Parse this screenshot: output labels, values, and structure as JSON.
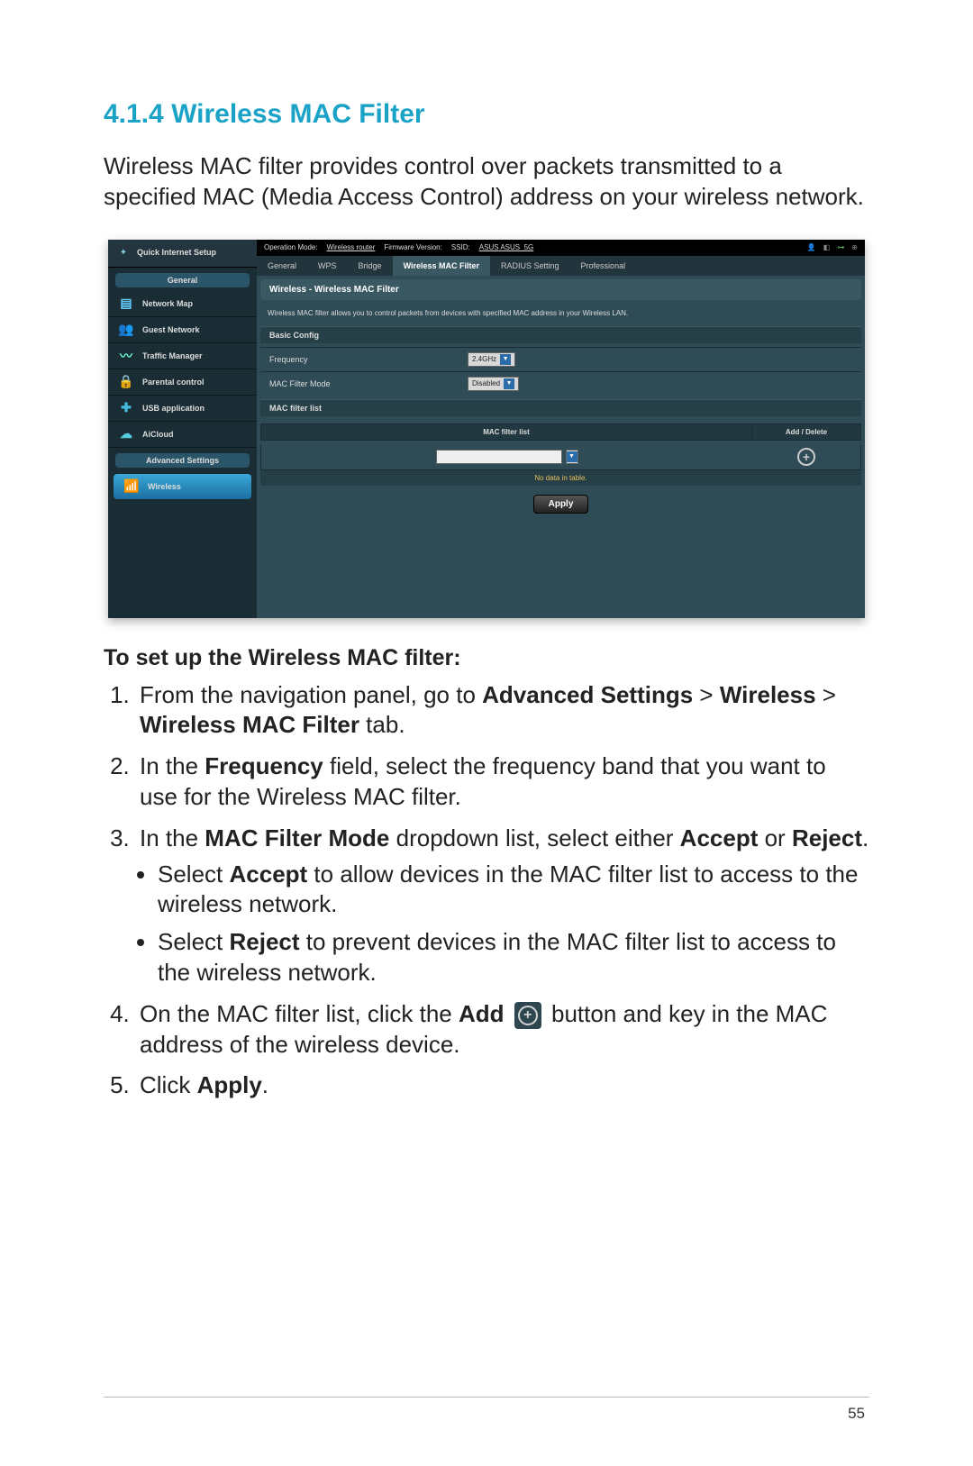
{
  "section": {
    "number": "4.1.4",
    "title": "Wireless MAC Filter"
  },
  "intro": "Wireless MAC filter provides control over packets transmitted to a specified MAC (Media Access Control) address on your wireless network.",
  "screenshot": {
    "sidebar": {
      "quick_setup": "Quick Internet Setup",
      "cat_general": "General",
      "cat_advanced": "Advanced Settings",
      "nav": {
        "network_map": "Network Map",
        "guest_network": "Guest Network",
        "traffic_manager": "Traffic Manager",
        "parental_control": "Parental control",
        "usb_app": "USB application",
        "aicloud": "AiCloud",
        "wireless": "Wireless"
      }
    },
    "topbar": {
      "op_mode_label": "Operation Mode:",
      "op_mode_value": "Wireless router",
      "fw_label": "Firmware Version:",
      "ssid_label": "SSID:",
      "ssid_value": "ASUS  ASUS_5G"
    },
    "tabs": {
      "general": "General",
      "wps": "WPS",
      "bridge": "Bridge",
      "mac_filter": "Wireless MAC Filter",
      "radius": "RADIUS Setting",
      "professional": "Professional"
    },
    "panel_title": "Wireless - Wireless MAC Filter",
    "panel_desc": "Wireless MAC filter allows you to control packets from devices with specified MAC address in your Wireless LAN.",
    "basic_config": "Basic Config",
    "freq_label": "Frequency",
    "freq_value": "2.4GHz",
    "mode_label": "MAC Filter Mode",
    "mode_value": "Disabled",
    "list_head": "MAC filter list",
    "th_list": "MAC filter list",
    "th_add": "Add / Delete",
    "no_data": "No data in table.",
    "apply": "Apply"
  },
  "instructions": {
    "title": "To set up the Wireless MAC filter:",
    "step1_a": "From the navigation panel, go to ",
    "step1_b": "Advanced Settings",
    "step1_c": " > ",
    "step1_d": "Wireless",
    "step1_e": " > ",
    "step1_f": "Wireless MAC Filter",
    "step1_g": " tab.",
    "step2_a": "In the ",
    "step2_b": "Frequency",
    "step2_c": " field, select the frequency band that you want to use for the Wireless MAC filter.",
    "step3_a": "In the ",
    "step3_b": "MAC Filter Mode",
    "step3_c": " dropdown list, select either ",
    "step3_d": "Accept",
    "step3_e": " or ",
    "step3_f": "Reject",
    "step3_g": ".",
    "sub1_a": "Select ",
    "sub1_b": "Accept",
    "sub1_c": " to allow devices in the MAC filter list to access to the wireless network.",
    "sub2_a": "Select ",
    "sub2_b": "Reject",
    "sub2_c": " to prevent devices in the MAC filter list to access to the wireless network.",
    "step4_a": "On the MAC filter list, click the ",
    "step4_b": "Add",
    "step4_c": " button and key in the MAC address of the wireless device.",
    "step5_a": "Click ",
    "step5_b": "Apply",
    "step5_c": "."
  },
  "page_number": "55"
}
